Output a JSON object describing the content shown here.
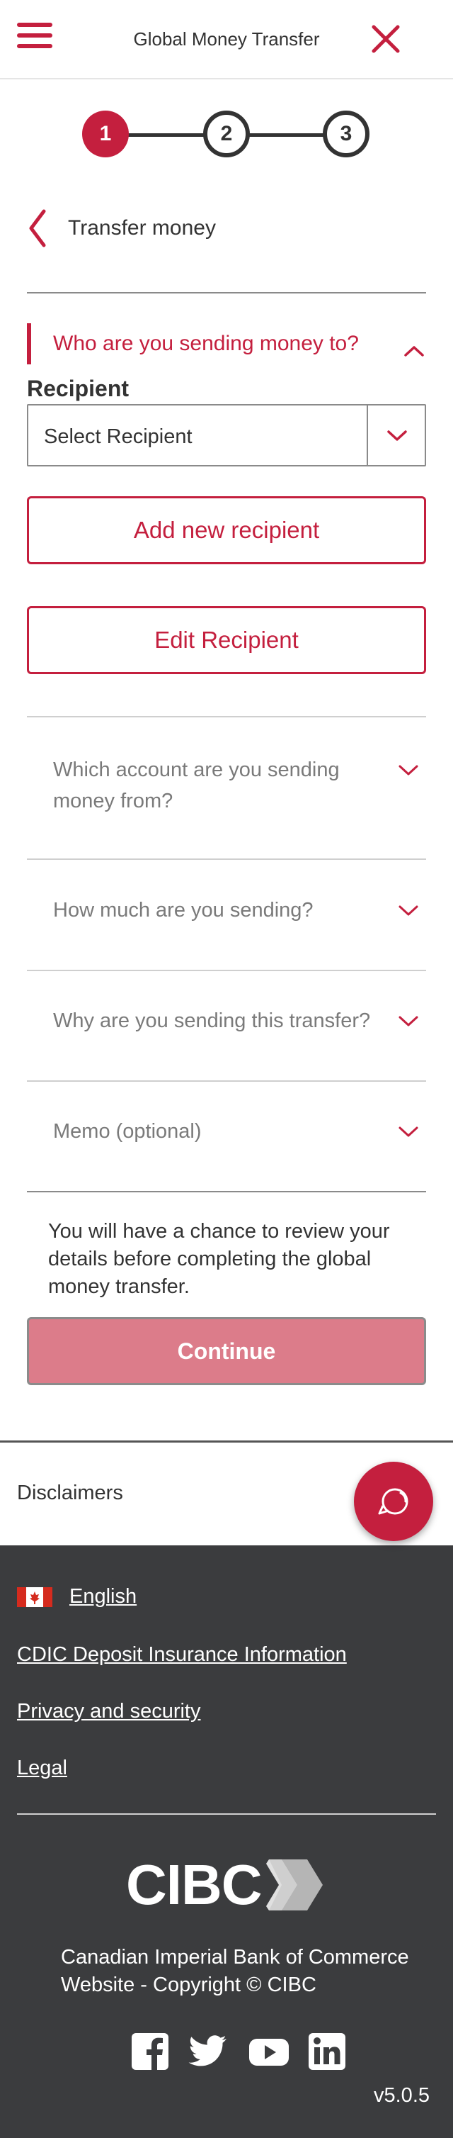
{
  "header": {
    "title": "Global Money Transfer",
    "menu_icon": "hamburger-menu-icon",
    "close_icon": "close-icon",
    "accent_color": "#c41f3e"
  },
  "stepper": {
    "steps": [
      "1",
      "2",
      "3"
    ],
    "current_step": 1
  },
  "nav": {
    "back_label": "Transfer money"
  },
  "recipient_section": {
    "title": "Who are you sending money to?",
    "field_label": "Recipient",
    "select_value": "Select Recipient",
    "add_button": "Add new recipient",
    "edit_button": "Edit Recipient"
  },
  "sections": [
    {
      "title": "Which account are you sending money from?"
    },
    {
      "title": "How much are you sending?"
    },
    {
      "title": "Why are you sending this transfer?"
    },
    {
      "title": "Memo (optional)"
    }
  ],
  "review_note": "You will have a chance to review your details before completing the global money transfer.",
  "continue_button": "Continue",
  "disclaimers_label": "Disclaimers",
  "footer": {
    "language_link": "English",
    "links": [
      "CDIC Deposit Insurance Information",
      "Privacy and security",
      "Legal"
    ],
    "logo_text": "CIBC",
    "copyright_line1": "Canadian Imperial Bank of Commerce",
    "copyright_line2": "Website - Copyright © CIBC",
    "social_icons": [
      "facebook-icon",
      "twitter-icon",
      "youtube-icon",
      "linkedin-icon"
    ],
    "version": "v5.0.5",
    "background_color": "#3b3c3e"
  }
}
